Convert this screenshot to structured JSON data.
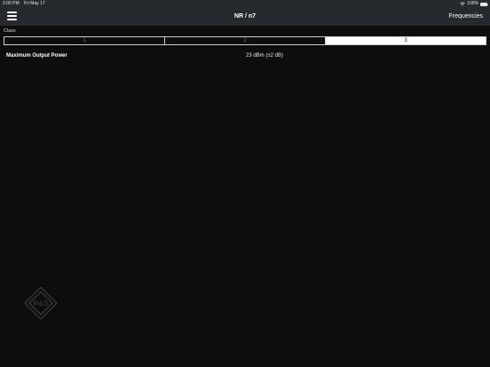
{
  "status_bar": {
    "time": "2:00 PM",
    "date": "Fri May 17",
    "battery": "100%"
  },
  "nav": {
    "title": "NR / n7",
    "action": "Frequencies",
    "menu_icon": "hamburger-menu-icon"
  },
  "class_selector": {
    "label": "Class",
    "options": [
      "1",
      "2",
      "3"
    ],
    "selected": "3"
  },
  "spec": {
    "label": "Maximum Output Power",
    "value": "23 dBm (±2 dB)"
  },
  "logo": {
    "text": "R&S"
  }
}
